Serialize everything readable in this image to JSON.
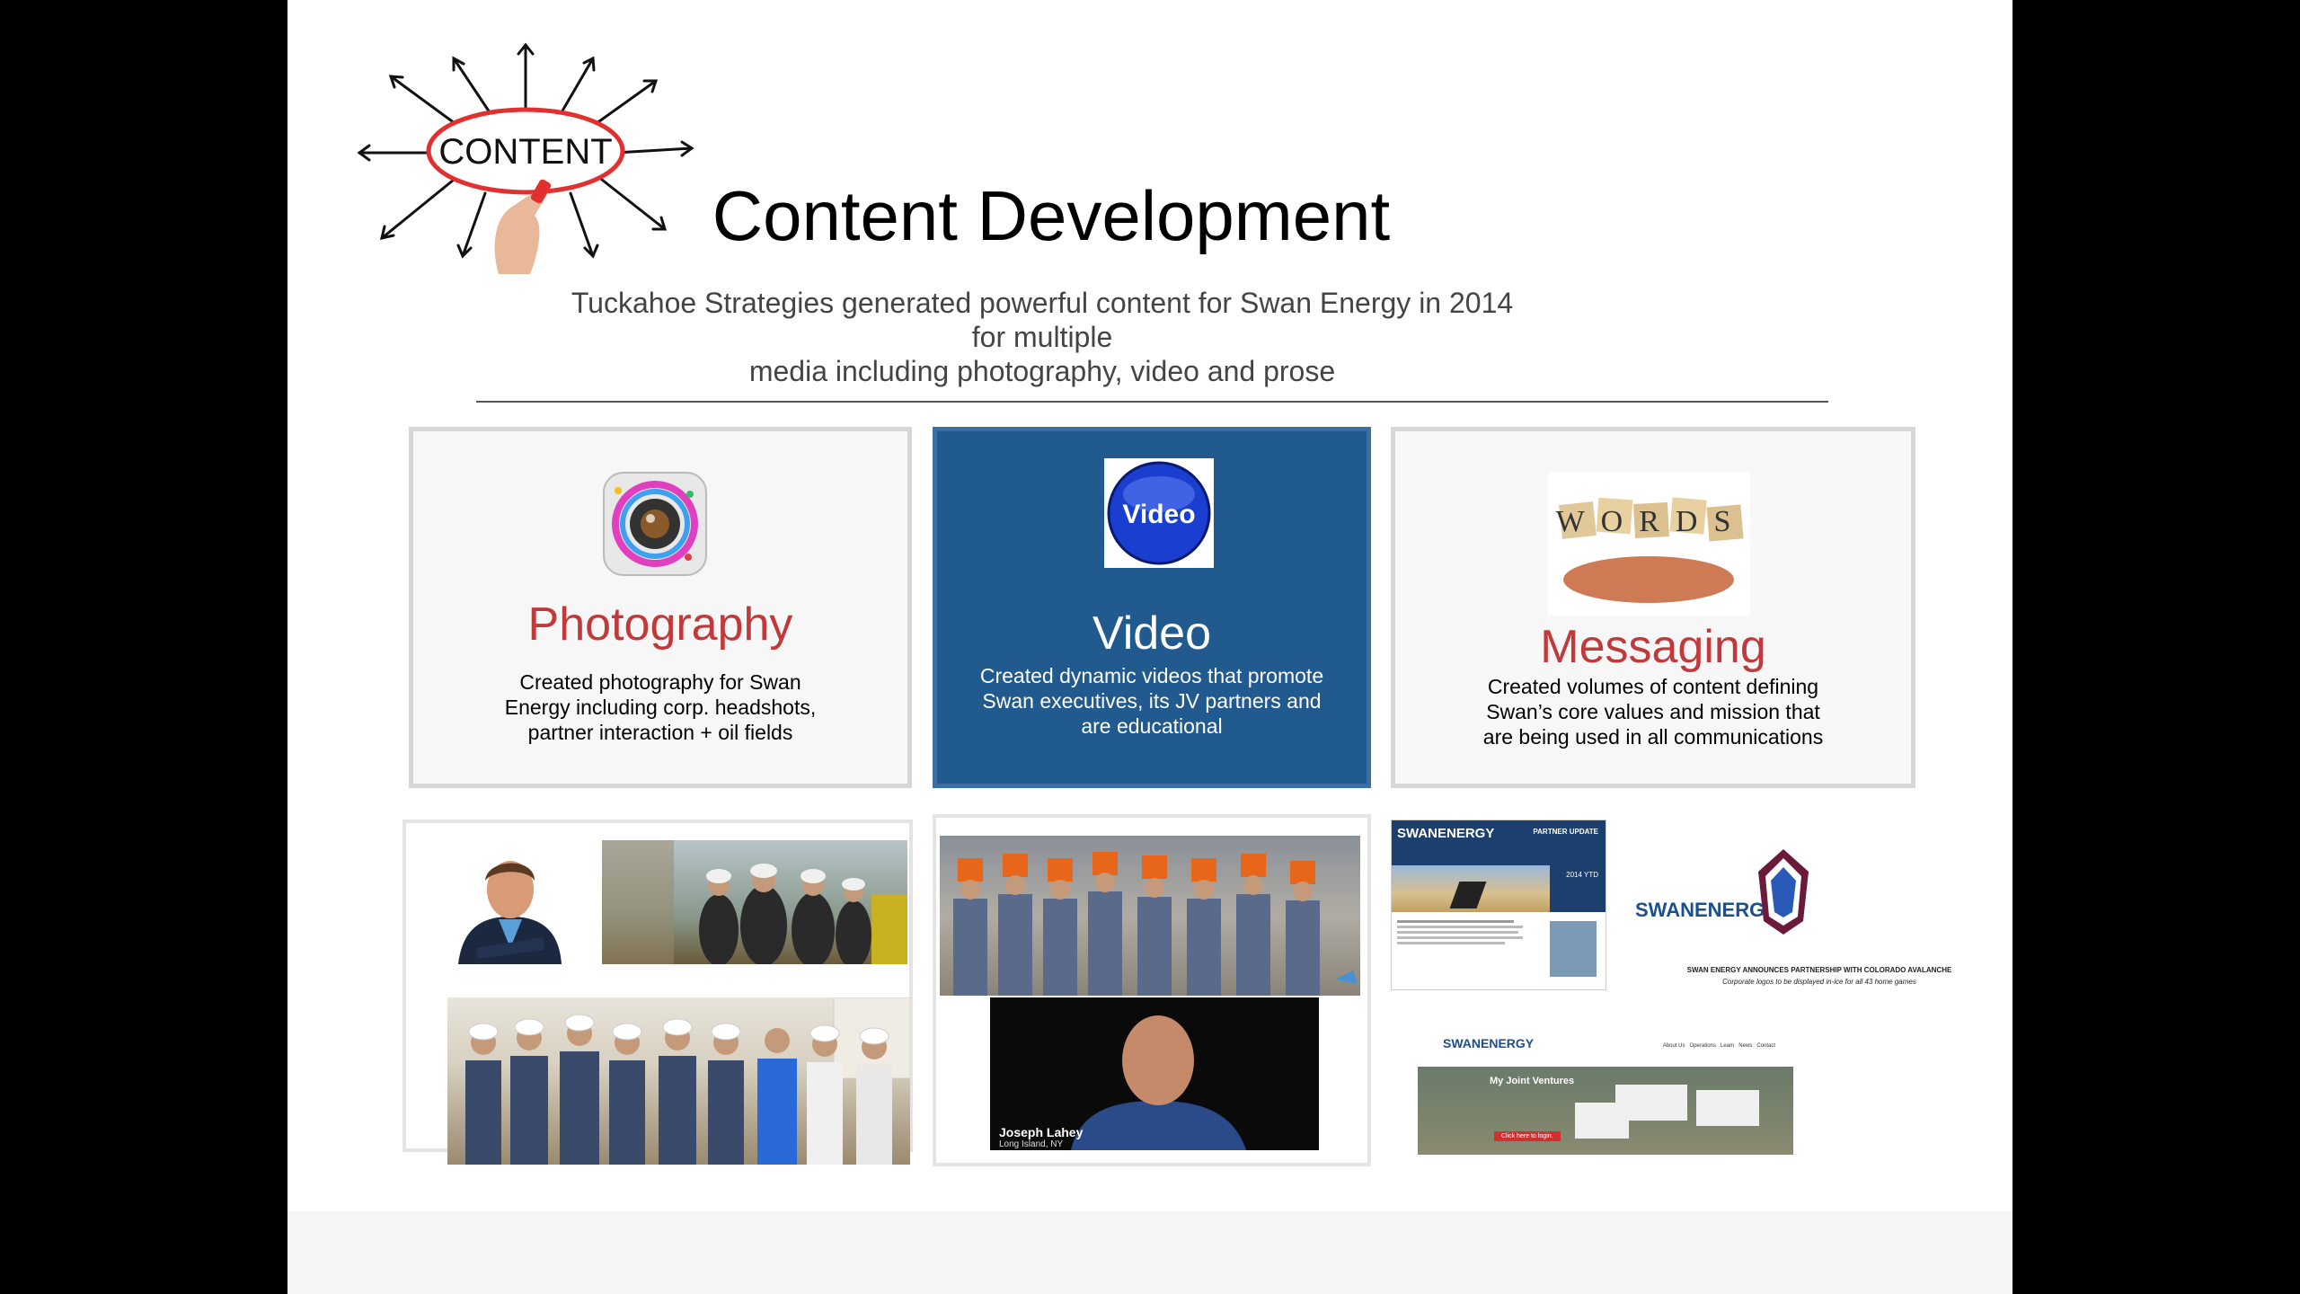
{
  "logo": {
    "word": "CONTENT"
  },
  "title": "Content Development",
  "subtitle": {
    "line1": "Tuckahoe Strategies generated powerful content for Swan Energy in 2014 for multiple",
    "line2": "media including photography, video and prose"
  },
  "cards": [
    {
      "heading": "Photography",
      "lines": [
        "Created photography for Swan",
        "Energy including corp. headshots,",
        "partner interaction + oil fields"
      ],
      "icon": "camera-lens-icon"
    },
    {
      "heading": "Video",
      "icon_label": "Video",
      "lines": [
        "Created dynamic videos that promote",
        "Swan executives, its JV partners and",
        "are educational"
      ],
      "icon": "video-globe-icon"
    },
    {
      "heading": "Messaging",
      "icon_label": "WORDS",
      "lines": [
        "Created volumes of content defining",
        "Swan’s core values and mission that",
        "are being used in all communications"
      ],
      "icon": "word-blocks-icon"
    }
  ],
  "video_panel": {
    "person_name": "Joseph Lahey",
    "person_location": "Long Island, NY"
  },
  "messaging_panel": {
    "newsletter_brand": "SWANENERGY",
    "newsletter_tag": "PARTNER UPDATE",
    "newsletter_stat": "2014 YTD",
    "logo_text": "SWANENERGY",
    "announcement": "SWAN ENERGY ANNOUNCES PARTNERSHIP WITH COLORADO AVALANCHE",
    "announcement_sub": "Corporate logos to be displayed in-ice for all 43 home games",
    "website_brand": "SWANENERGY",
    "website_nav": [
      "About Us",
      "Operations",
      "Learn",
      "News",
      "Contact"
    ],
    "website_heading": "My Joint Ventures",
    "website_button": "Click here to login."
  },
  "colors": {
    "accent_red": "#c0393b",
    "video_blue": "#205a8f",
    "divider": "#555555"
  }
}
